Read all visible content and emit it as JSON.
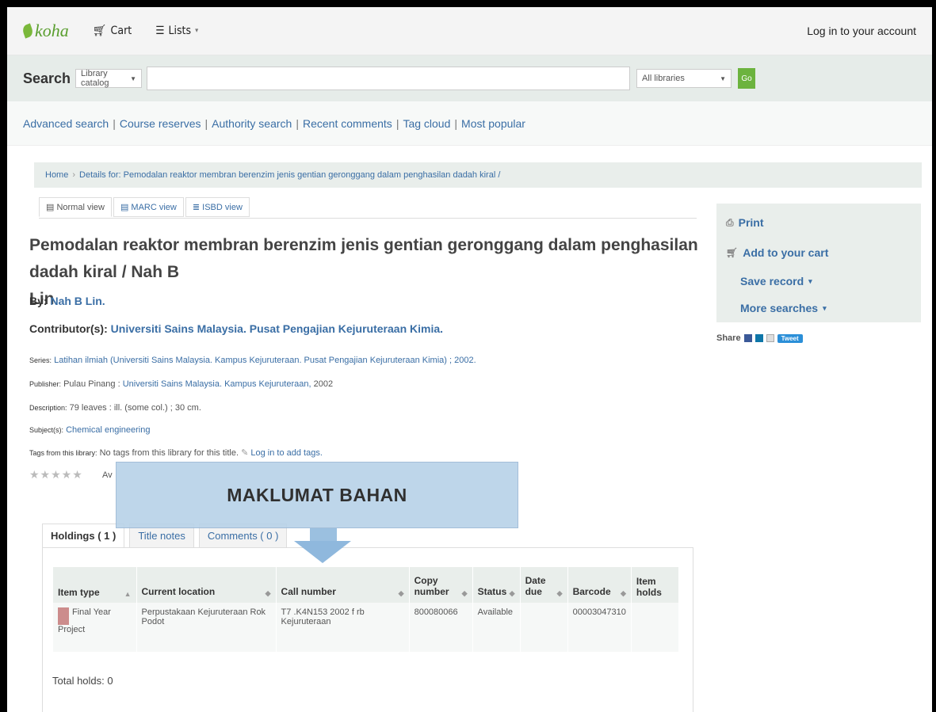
{
  "navbar": {
    "logo": "koha",
    "cart": "Cart",
    "lists": "Lists",
    "login": "Log in to your account"
  },
  "search": {
    "label": "Search",
    "scope": "Library catalog",
    "query": "",
    "library": "All libraries",
    "go": "Go"
  },
  "moresearches": [
    "Advanced search",
    "Course reserves",
    "Authority search",
    "Recent comments",
    "Tag cloud",
    "Most popular"
  ],
  "breadcrumb": {
    "home": "Home",
    "current": "Details for: Pemodalan reaktor membran berenzim jenis gentian geronggang dalam penghasilan dadah kiral /"
  },
  "views": [
    "Normal view",
    "MARC view",
    "ISBD view"
  ],
  "record": {
    "title_line1": "Pemodalan reaktor membran berenzim jenis gentian geronggang dalam penghasilan dadah kiral / Nah B",
    "title_line2": "Lin",
    "by_label": "By:",
    "author": "Nah B Lin.",
    "contrib_label": "Contributor(s):",
    "contributor": "Universiti Sains Malaysia. Pusat Pengajian Kejuruteraan Kimia.",
    "series_label": "Series:",
    "series": "Latihan ilmiah (Universiti Sains Malaysia. Kampus Kejuruteraan. Pusat Pengajian Kejuruteraan Kimia) ; 2002.",
    "publisher_label": "Publisher:",
    "publisher_place": "Pulau Pinang :",
    "publisher": "Universiti Sains Malaysia. Kampus Kejuruteraan,",
    "publisher_year": "2002",
    "description_label": "Description:",
    "description": "79 leaves : ill. (some col.) ; 30 cm.",
    "subjects_label": "Subject(s):",
    "subject": "Chemical engineering",
    "tags_label": "Tags from this library:",
    "tags_text": "No tags from this library for this title.",
    "tags_login": "Log in to add tags.",
    "rating_stars": "★★★★★",
    "rating_text": "Av"
  },
  "sidebar": {
    "print": "Print",
    "add_cart": "Add to your cart",
    "save_record": "Save record",
    "more_searches": "More searches",
    "share": "Share",
    "tweet": "Tweet"
  },
  "holding_tabs": [
    "Holdings ( 1 )",
    "Title notes",
    "Comments ( 0 )"
  ],
  "holdings": {
    "columns": [
      "Item type",
      "Current location",
      "Call number",
      "Copy number",
      "Status",
      "Date due",
      "Barcode",
      "Item holds"
    ],
    "rows": [
      [
        "Final Year Project",
        "Perpustakaan Kejuruteraan Rok Podot",
        "T7 .K4N153 2002 f rb Kejuruteraan",
        "800080066",
        "Available",
        "",
        "00003047310",
        ""
      ]
    ],
    "total": "Total holds: 0"
  },
  "callout": "MAKLUMAT BAHAN"
}
